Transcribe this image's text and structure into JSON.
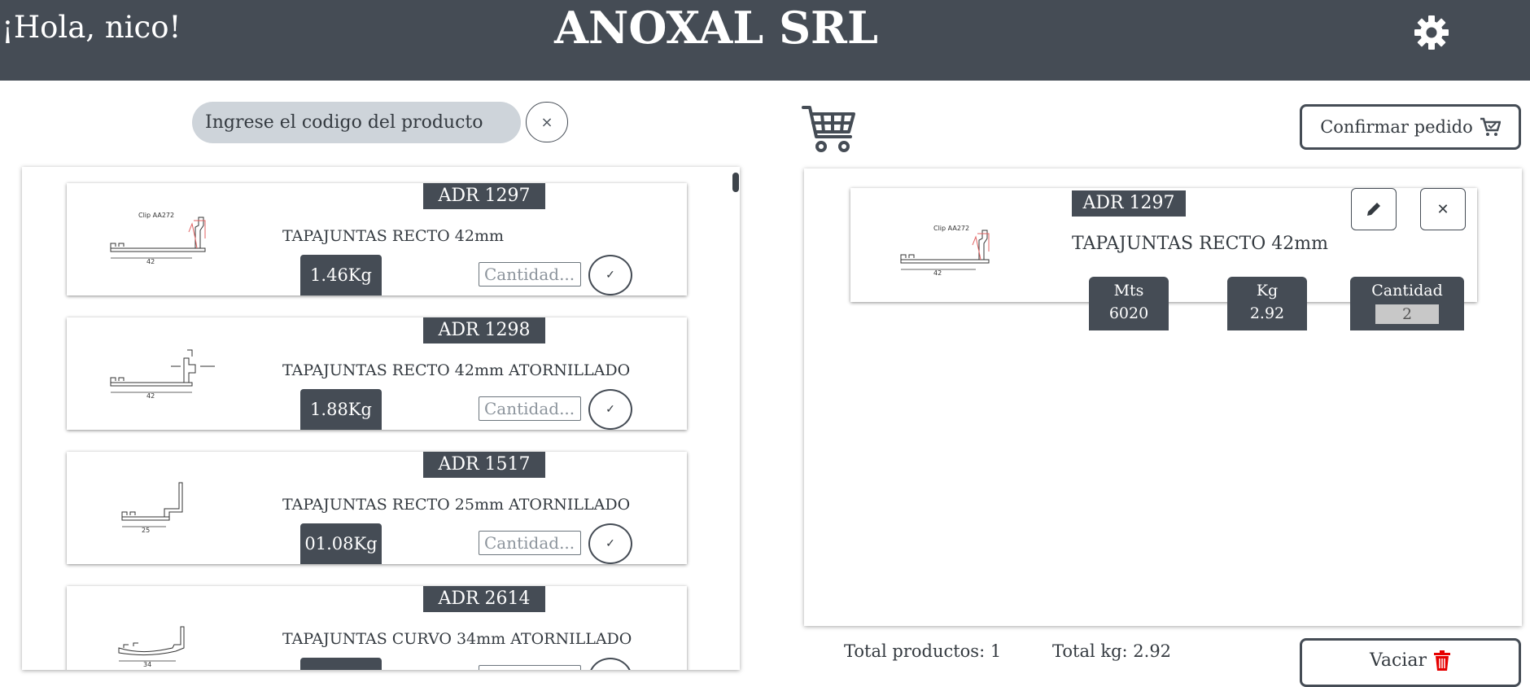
{
  "header": {
    "greeting": "¡Hola, nico!",
    "brand": "ANOXAL SRL",
    "settings_icon": "gear-icon"
  },
  "search": {
    "placeholder": "Ingrese el codigo del producto",
    "clear_label": "×"
  },
  "products": [
    {
      "code": "ADR 1297",
      "name": "TAPAJUNTAS RECTO 42mm",
      "weight": "1.46Kg",
      "qty_placeholder": "Cantidad...",
      "drawing_label": "Clip AA272",
      "dim": "42"
    },
    {
      "code": "ADR 1298",
      "name": "TAPAJUNTAS RECTO 42mm ATORNILLADO",
      "weight": "1.88Kg",
      "qty_placeholder": "Cantidad...",
      "dim": "42"
    },
    {
      "code": "ADR 1517",
      "name": "TAPAJUNTAS RECTO 25mm ATORNILLADO",
      "weight": "01.08Kg",
      "qty_placeholder": "Cantidad...",
      "dim": "25"
    },
    {
      "code": "ADR 2614",
      "name": "TAPAJUNTAS CURVO 34mm ATORNILLADO",
      "weight": "",
      "qty_placeholder": "Cantidad...",
      "dim": "34"
    }
  ],
  "cart": {
    "icon": "cart-icon",
    "confirm_label": "Confirmar pedido",
    "items": [
      {
        "code": "ADR 1297",
        "name": "TAPAJUNTAS RECTO 42mm",
        "drawing_label": "Clip AA272",
        "dim": "42",
        "mts_label": "Mts",
        "mts_value": "6020",
        "kg_label": "Kg",
        "kg_value": "2.92",
        "qty_label": "Cantidad",
        "qty_value": "2"
      }
    ],
    "total_products": "Total productos: 1",
    "total_kg": "Total kg: 2.92",
    "empty_label": "Vaciar"
  },
  "colors": {
    "header_bg": "#454c55",
    "badge_bg": "#454c55",
    "trash_red": "#e60000"
  }
}
